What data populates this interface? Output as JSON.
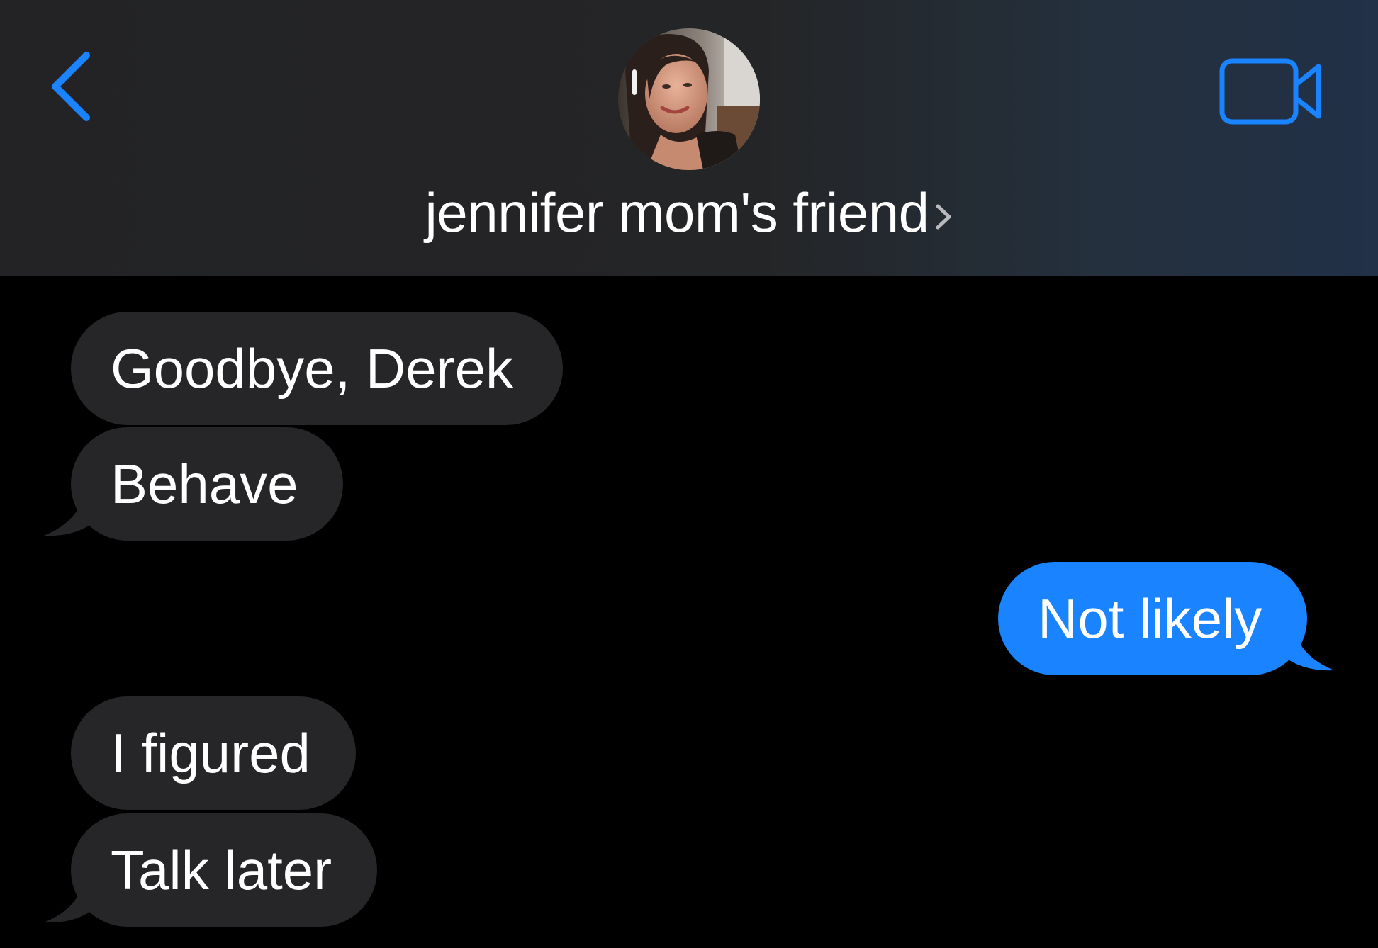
{
  "header": {
    "contact_name": "jennifer mom's friend",
    "back_icon": "chevron-left-icon",
    "video_icon": "video-camera-icon",
    "detail_icon": "chevron-right-icon",
    "accent_color": "#1a83ff"
  },
  "messages": [
    {
      "direction": "incoming",
      "text": "Goodbye, Derek",
      "tail": false
    },
    {
      "direction": "incoming",
      "text": "Behave",
      "tail": true
    },
    {
      "direction": "outgoing",
      "text": "Not likely",
      "tail": true
    },
    {
      "direction": "incoming",
      "text": "I figured",
      "tail": false
    },
    {
      "direction": "incoming",
      "text": "Talk later",
      "tail": true
    }
  ],
  "colors": {
    "incoming_bubble": "#262629",
    "outgoing_bubble": "#1a83ff",
    "background": "#000000"
  }
}
